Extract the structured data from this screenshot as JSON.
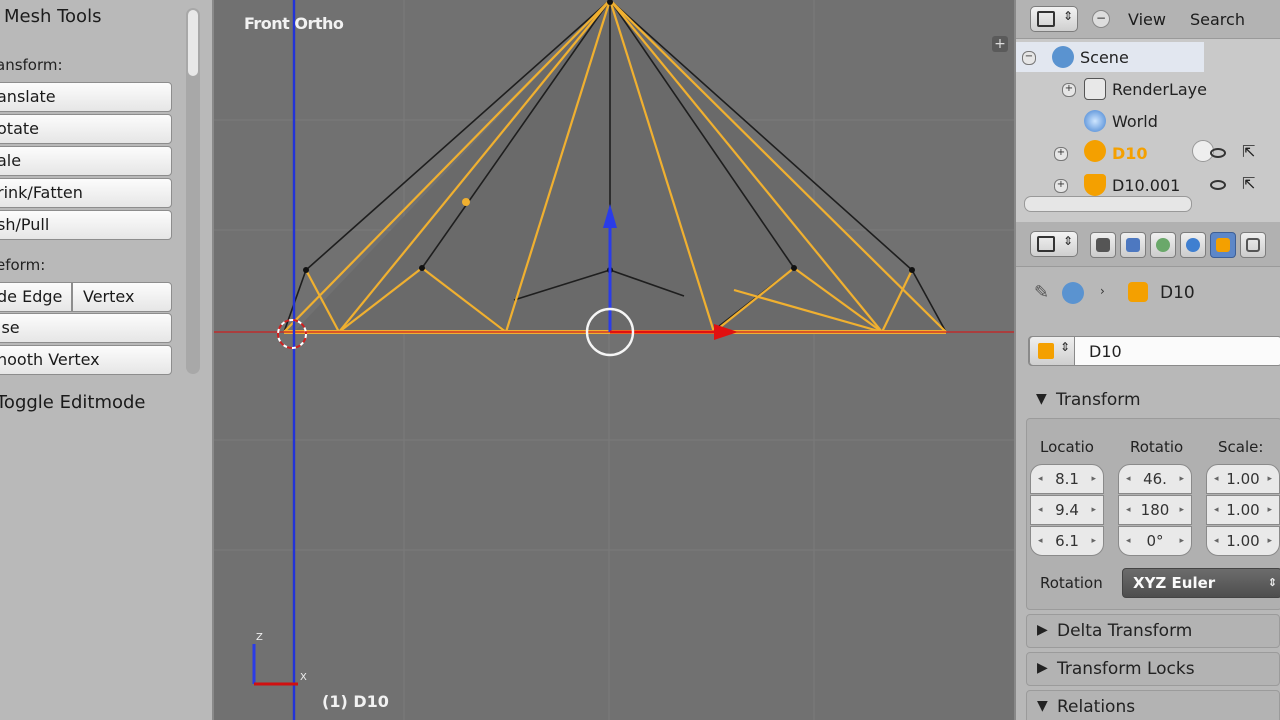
{
  "toolshelf": {
    "title": "Mesh Tools",
    "transform_label": "ansform:",
    "transform_buttons": [
      "anslate",
      "otate",
      "ale",
      "rink/Fatten",
      "sh/Pull"
    ],
    "deform_label": "eform:",
    "slide_edge": "de Edge",
    "vertex": "Vertex",
    "noise": "ise",
    "smooth_vertex": "nooth Vertex",
    "toggle_editmode": "Toggle Editmode"
  },
  "viewport": {
    "view_name": "Front Ortho",
    "object_label": "(1) D10",
    "axis_z": "Z",
    "axis_x": "X",
    "colors": {
      "background": "#717171",
      "selected_edge": "#f0b030",
      "edge": "#1e1e1e",
      "z_axis": "#1a2fd0",
      "x_axis": "#d01010"
    }
  },
  "outliner": {
    "menu_view": "View",
    "menu_search": "Search",
    "items": [
      {
        "label": "Scene",
        "icon": "scene-icon"
      },
      {
        "label": "RenderLaye",
        "icon": "render-layers-icon"
      },
      {
        "label": "World",
        "icon": "world-icon"
      },
      {
        "label": "D10",
        "icon": "mesh-object-icon"
      },
      {
        "label": "D10.001",
        "icon": "mesh-object-icon"
      }
    ]
  },
  "properties": {
    "breadcrumb_object": "D10",
    "object_name": "D10",
    "transform_header": "Transform",
    "location_label": "Locatio",
    "rotation_label": "Rotatio",
    "scale_label": "Scale:",
    "location": [
      "8.1",
      "9.4",
      "6.1"
    ],
    "rotation": [
      "46.",
      "180",
      "0°"
    ],
    "scale": [
      "1.00",
      "1.00",
      "1.00"
    ],
    "rotation_mode_label": "Rotation",
    "rotation_mode": "XYZ Euler",
    "delta_transform": "Delta Transform",
    "transform_locks": "Transform Locks",
    "relations": "Relations"
  }
}
